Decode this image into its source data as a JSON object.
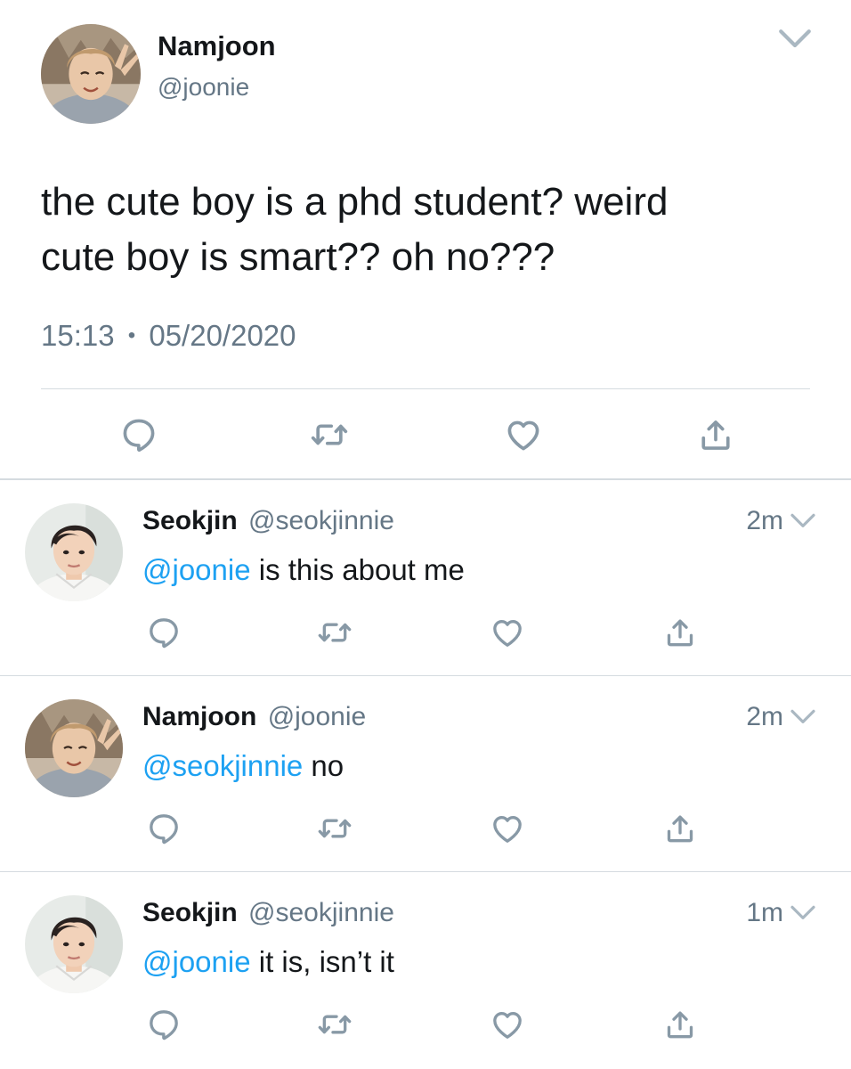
{
  "main_tweet": {
    "author_name": "Namjoon",
    "author_handle": "@joonie",
    "text_line1": "the cute boy is a phd student? weird",
    "text_line2": "cute boy is smart?? oh no???",
    "time": "15:13",
    "separator": "•",
    "date": "05/20/2020",
    "actions": [
      "reply-icon",
      "retweet-icon",
      "like-icon",
      "share-icon"
    ]
  },
  "replies": [
    {
      "author_name": "Seokjin",
      "author_handle": "@seokjinnie",
      "time": "2m",
      "mention": "@joonie",
      "text": " is this about me"
    },
    {
      "author_name": "Namjoon",
      "author_handle": "@joonie",
      "time": "2m",
      "mention": "@seokjinnie",
      "text": " no"
    },
    {
      "author_name": "Seokjin",
      "author_handle": "@seokjinnie",
      "time": "1m",
      "mention": "@joonie",
      "text": " it is, isn’t it"
    }
  ],
  "colors": {
    "text": "#14171a",
    "secondary": "#657786",
    "mention": "#1da1f2",
    "icon": "#8899a6",
    "divider": "#d5dbe0"
  }
}
